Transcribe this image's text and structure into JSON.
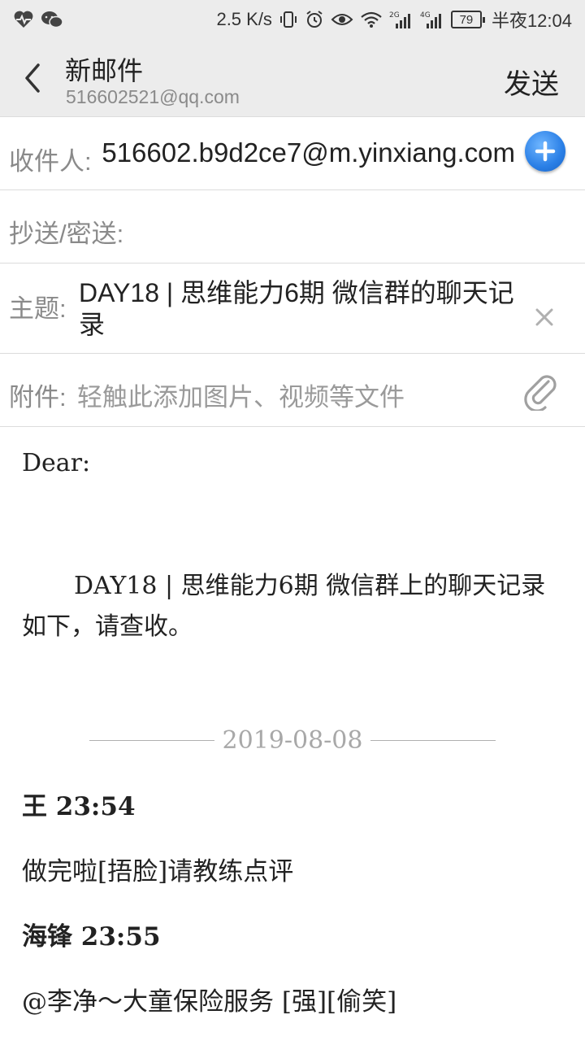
{
  "status_bar": {
    "left_icons": [
      "heart-rate-icon",
      "wechat-icon"
    ],
    "net_speed": "2.5 K/s",
    "network_26": "2G",
    "network_46": "4G",
    "battery": "79",
    "time": "半夜12:04"
  },
  "header": {
    "title": "新邮件",
    "account": "516602521@qq.com",
    "send_label": "发送"
  },
  "form": {
    "to_label": "收件人:",
    "to_value": "516602.b9d2ce7@m.yinxiang.com",
    "cc_label": "抄送/密送:",
    "cc_value": "",
    "subject_label": "主题:",
    "subject_value": "DAY18 | 思维能力6期 微信群的聊天记录",
    "attach_label": "附件:",
    "attach_hint": "轻触此添加图片、视频等文件"
  },
  "body": {
    "greeting": "Dear:",
    "intro": "DAY18 | 思维能力6期 微信群上的聊天记录如下，请查收。",
    "date": "2019-08-08",
    "messages": [
      {
        "sender": "王 23:54",
        "text": "做完啦[捂脸]请教练点评"
      },
      {
        "sender": "海锋 23:55",
        "text": "@李净～大童保险服务 [强][偷笑]"
      }
    ]
  },
  "colors": {
    "header_bg": "#ececec",
    "add_button": "#2a7fe6",
    "label_gray": "#8a8a8a"
  }
}
